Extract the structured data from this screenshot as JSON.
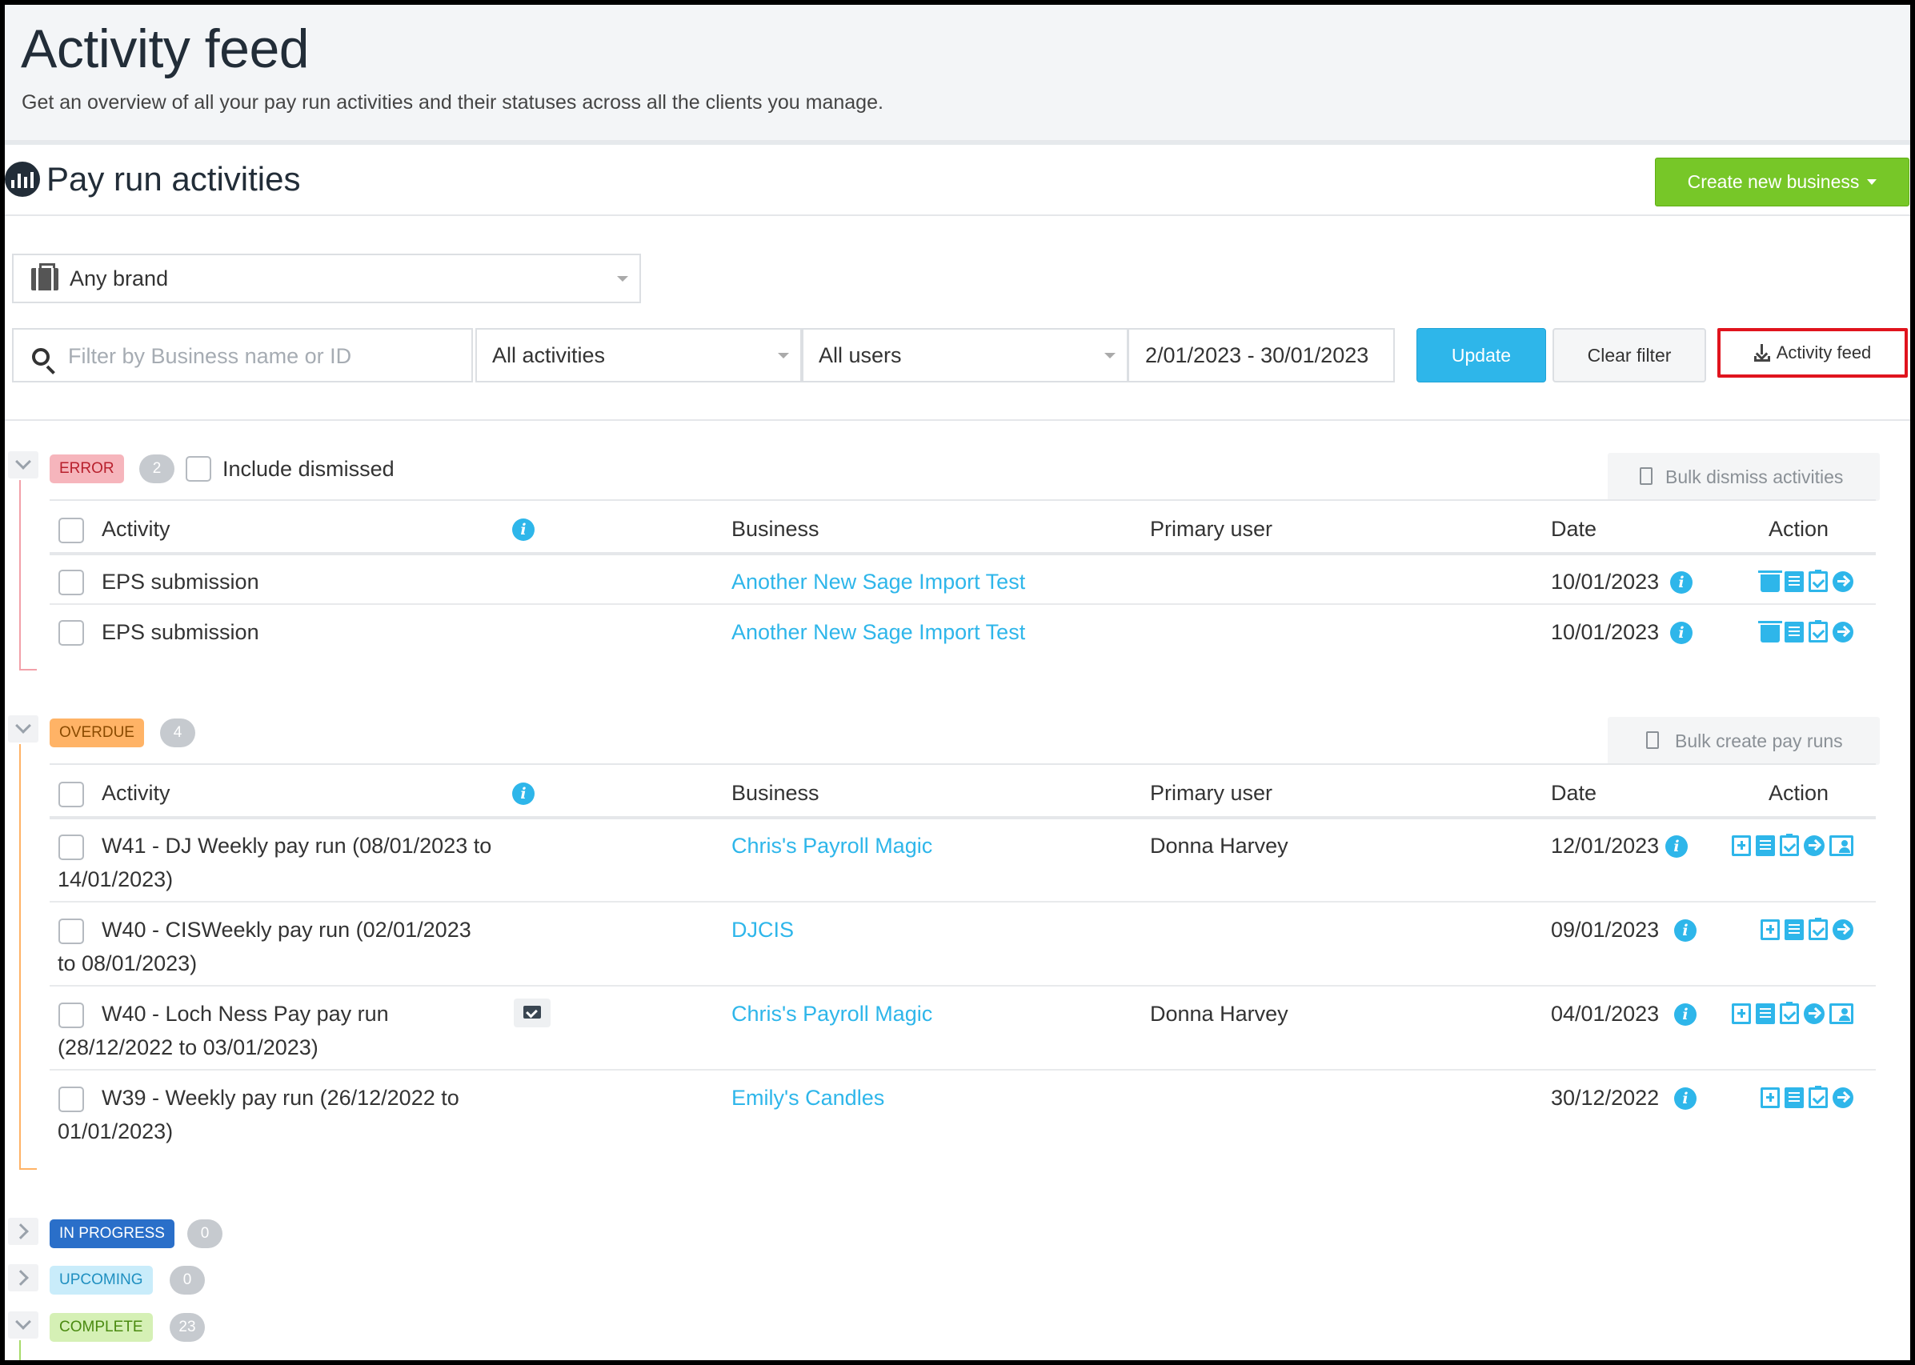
{
  "header": {
    "title": "Activity feed",
    "subtitle": "Get an overview of all your pay run activities and their statuses across all the clients you manage."
  },
  "section": {
    "title": "Pay run activities",
    "icon": "bar-chart-icon",
    "create_button": "Create new business"
  },
  "filters": {
    "brand": "Any brand",
    "search_placeholder": "Filter by Business name or ID",
    "search_value": "",
    "activities": "All activities",
    "users": "All users",
    "date_range": "2/01/2023 - 30/01/2023",
    "update_label": "Update",
    "clear_label": "Clear filter",
    "export_label": "Activity feed"
  },
  "columns": {
    "activity": "Activity",
    "business": "Business",
    "primary_user": "Primary user",
    "date": "Date",
    "action": "Action"
  },
  "error_group": {
    "badge": "ERROR",
    "count": "2",
    "include_dismissed": "Include dismissed",
    "bulk_label": "Bulk dismiss activities",
    "rows": [
      {
        "activity": "EPS submission",
        "business": "Another New Sage Import Test",
        "user": "",
        "date": "10/01/2023"
      },
      {
        "activity": "EPS submission",
        "business": "Another New Sage Import Test",
        "user": "",
        "date": "10/01/2023"
      }
    ]
  },
  "overdue_group": {
    "badge": "OVERDUE",
    "count": "4",
    "bulk_label": "Bulk create pay runs",
    "rows": [
      {
        "activity_l1": "W41 - DJ Weekly pay run (08/01/2023 to",
        "activity_l2": "14/01/2023)",
        "business": "Chris's Payroll Magic",
        "user": "Donna Harvey",
        "date": "12/01/2023"
      },
      {
        "activity_l1": "W40 - CISWeekly pay run (02/01/2023",
        "activity_l2": "to 08/01/2023)",
        "business": "DJCIS",
        "user": "",
        "date": "09/01/2023"
      },
      {
        "activity_l1": "W40 - Loch Ness Pay pay run",
        "activity_l2": "(28/12/2022 to 03/01/2023)",
        "business": "Chris's Payroll Magic",
        "user": "Donna Harvey",
        "date": "04/01/2023"
      },
      {
        "activity_l1": "W39 - Weekly pay run (26/12/2022 to",
        "activity_l2": "01/01/2023)",
        "business": "Emily's Candles",
        "user": "",
        "date": "30/12/2022"
      }
    ]
  },
  "other_groups": {
    "in_progress": {
      "badge": "IN PROGRESS",
      "count": "0"
    },
    "upcoming": {
      "badge": "UPCOMING",
      "count": "0"
    },
    "complete": {
      "badge": "COMPLETE",
      "count": "23"
    }
  },
  "colors": {
    "accent": "#2eb6ea",
    "create_button": "#77c728",
    "error": "#f6b5bc",
    "overdue": "#ffb366",
    "in_progress": "#2a6fc9",
    "upcoming": "#c9ecfa",
    "complete": "#d5f0b5",
    "highlight": "#e0141e"
  }
}
